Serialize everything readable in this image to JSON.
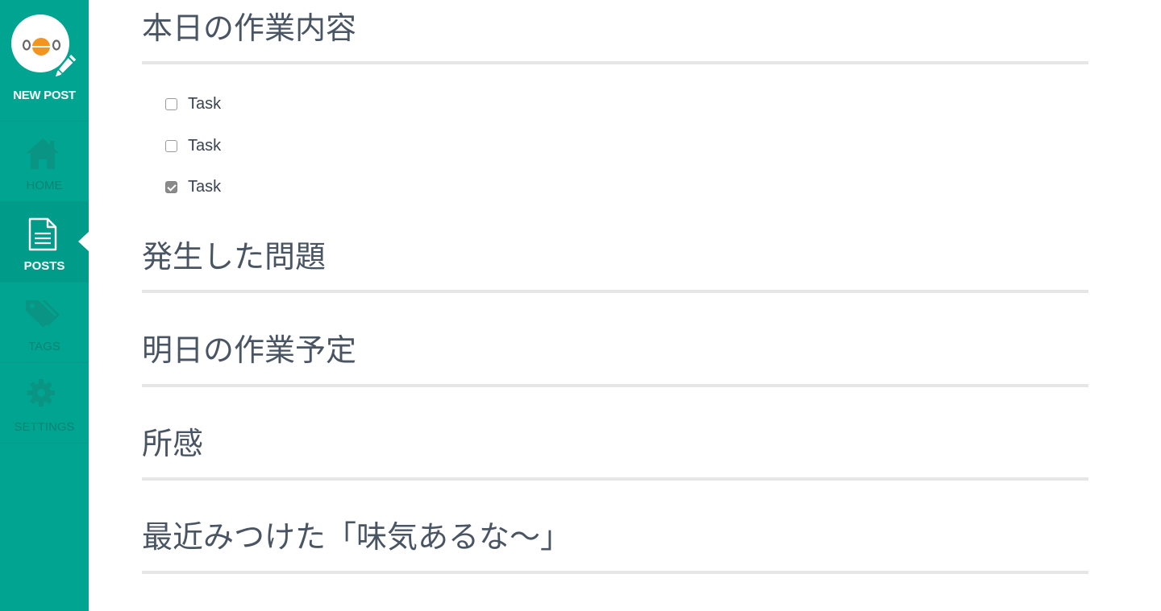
{
  "sidebar": {
    "new_post_label": "NEW POST",
    "logo_icon": "owl-logo-icon",
    "nav": [
      {
        "label": "HOME",
        "icon": "home-icon",
        "active": false
      },
      {
        "label": "POSTS",
        "icon": "document-icon",
        "active": true
      },
      {
        "label": "TAGS",
        "icon": "tags-icon",
        "active": false
      },
      {
        "label": "SETTINGS",
        "icon": "gear-icon",
        "active": false
      }
    ]
  },
  "content": {
    "sections": [
      {
        "title": "本日の作業内容"
      },
      {
        "title": "発生した問題"
      },
      {
        "title": "明日の作業予定"
      },
      {
        "title": "所感"
      },
      {
        "title": "最近みつけた「味気あるな〜」"
      }
    ],
    "tasks": [
      {
        "label": "Task",
        "checked": false
      },
      {
        "label": "Task",
        "checked": false
      },
      {
        "label": "Task",
        "checked": true
      }
    ]
  },
  "colors": {
    "sidebar_bg": "#00a491",
    "sidebar_active_bg": "#009c89",
    "logo_accent": "#f29420",
    "heading_text": "#4a5563",
    "divider": "#e6e6e6"
  }
}
